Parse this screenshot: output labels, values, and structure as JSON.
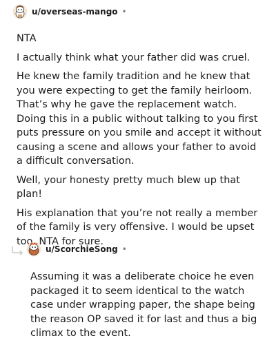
{
  "comment_1": {
    "username": "u/overseas-mango",
    "separator": "•",
    "paragraphs": [
      "NTA",
      "I actually think what your father did was cruel.",
      "He knew the family tradition and he knew that you were expecting to get the family heirloom. That’s why he gave the replacement watch. Doing this in a public without talking to you first puts pressure on you smile and accept it without causing a scene and allows your father to avoid a difficult conversation.",
      "Well, your honesty pretty much blew up that plan!",
      "His explanation that you’re not really a member of the family is very offensive. I would be upset too. NTA for sure."
    ]
  },
  "comment_2": {
    "username": "u/ScorchieSong",
    "separator": "•",
    "paragraphs": [
      "Assuming it was a deliberate choice he even packaged it to seem identical to the watch case under wrapping paper, the shape being the reason OP saved it for last and thus a big climax to the event."
    ]
  },
  "icons": {
    "avatar_1": "snoo-avatar-icon",
    "avatar_2": "snoo-avatar-icon",
    "reply": "reply-arrow-icon"
  },
  "colors": {
    "text": "#1c1c1c",
    "muted": "#7c7c7c",
    "reply_arrow": "#c9c9c9"
  }
}
